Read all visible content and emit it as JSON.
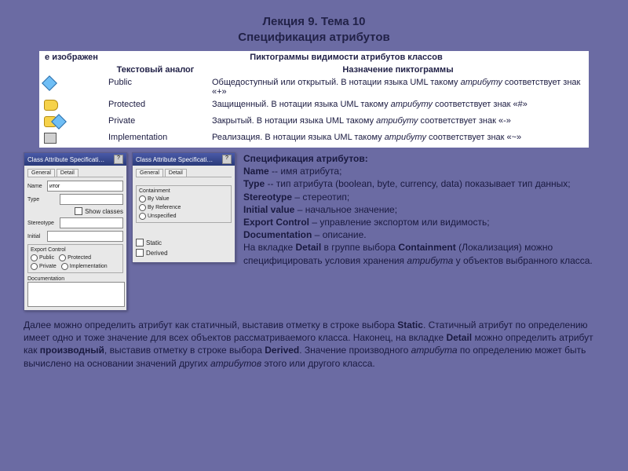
{
  "lecture": {
    "line1": "Лекция 9. Тема 10",
    "line2": "Спецификация атрибутов"
  },
  "table": {
    "caption": "Пиктограммы видимости атрибутов классов",
    "head": {
      "c1": "е изображен",
      "c2": "Текстовый аналог",
      "c3": "Назначение пиктограммы"
    },
    "rows": [
      {
        "icon": "public-icon",
        "text_analog": "Public",
        "desc_pre": "Общедоступный или открытый. В нотации языка UML такому ",
        "desc_i": "атрибуту",
        "desc_post": " соответствует знак «+»"
      },
      {
        "icon": "protected-icon",
        "text_analog": "Protected",
        "desc_pre": "Защищенный. В нотации языка UML такому ",
        "desc_i": "атрибуту",
        "desc_post": " соответствует знак «#»"
      },
      {
        "icon": "private-icon",
        "text_analog": "Private",
        "desc_pre": "Закрытый. В нотации языка UML такому ",
        "desc_i": "атрибуту",
        "desc_post": " соответствует знак «-»"
      },
      {
        "icon": "implementation-icon",
        "text_analog": "Implementation",
        "desc_pre": "Реализация. В нотации языка UML такому ",
        "desc_i": "атрибуту",
        "desc_post": " соответствует знак «~»"
      }
    ]
  },
  "dialog1": {
    "title": "Class Attribute Specificati…",
    "tabs": [
      "General",
      "Detail"
    ],
    "fields": {
      "name_label": "Name",
      "name_value": "итог",
      "type_label": "Type",
      "type_value": "",
      "show_classes": "Show classes",
      "stereotype_label": "Stereotype",
      "initial_label": "Initial",
      "export_title": "Export Control",
      "export_opts": [
        "Public",
        "Protected",
        "Private",
        "Implementation"
      ],
      "doc_label": "Documentation"
    }
  },
  "dialog2": {
    "title": "Class Attribute Specificati…",
    "tabs": [
      "General",
      "Detail"
    ],
    "containment_title": "Containment",
    "containment_opts": [
      "By Value",
      "By Reference",
      "Unspecified"
    ],
    "static_label": "Static",
    "derived_label": "Derived"
  },
  "spec": {
    "title": "Спецификация атрибутов:",
    "lines": [
      {
        "b": "Name",
        "sep": " -- ",
        "t": "имя атрибута;"
      },
      {
        "b": "Type",
        "sep": " -- ",
        "t": "тип атрибута (boolean, byte, currency, data) показывает тип данных;"
      },
      {
        "b": "Stereotype",
        "sep": " – ",
        "t": "стереотип;"
      },
      {
        "b": "Initial value",
        "sep": " – ",
        "t": "начальное значение;"
      },
      {
        "b": "Export Control",
        "sep": " – ",
        "t": "управление экспортом или видимость;"
      },
      {
        "b": "Documentation",
        "sep": " – ",
        "t": "описание."
      }
    ],
    "detail_pre": "На вкладке ",
    "detail_b1": "Detail",
    "detail_mid": " в группе выбора ",
    "detail_b2": "Containment",
    "detail_post1": " (Локализация) можно специфицировать условия хранения ",
    "detail_i": "атрибута",
    "detail_post2": " у объектов выбранного класса."
  },
  "bottom": {
    "p1_pre": "Далее можно определить атрибут как статичный, выставив отметку в строке выбора ",
    "p1_b1": "Static",
    "p1_mid": ". Статичный атрибут по определению имеет одно и тоже значение для всех объектов рассматриваемого класса. Наконец, на вкладке ",
    "p1_b2": "Detail",
    "p1_mid2": " можно определить атрибут как ",
    "p1_b3": "производный",
    "p1_mid3": ", выставив отметку в строке выбора ",
    "p1_b4": "Derived",
    "p1_mid4": ". Значение производного ",
    "p1_i1": "атрибута",
    "p1_mid5": " по определению может быть вычислено на основании значений других ",
    "p1_i2": "атрибутов",
    "p1_end": " этого или другого класса."
  }
}
